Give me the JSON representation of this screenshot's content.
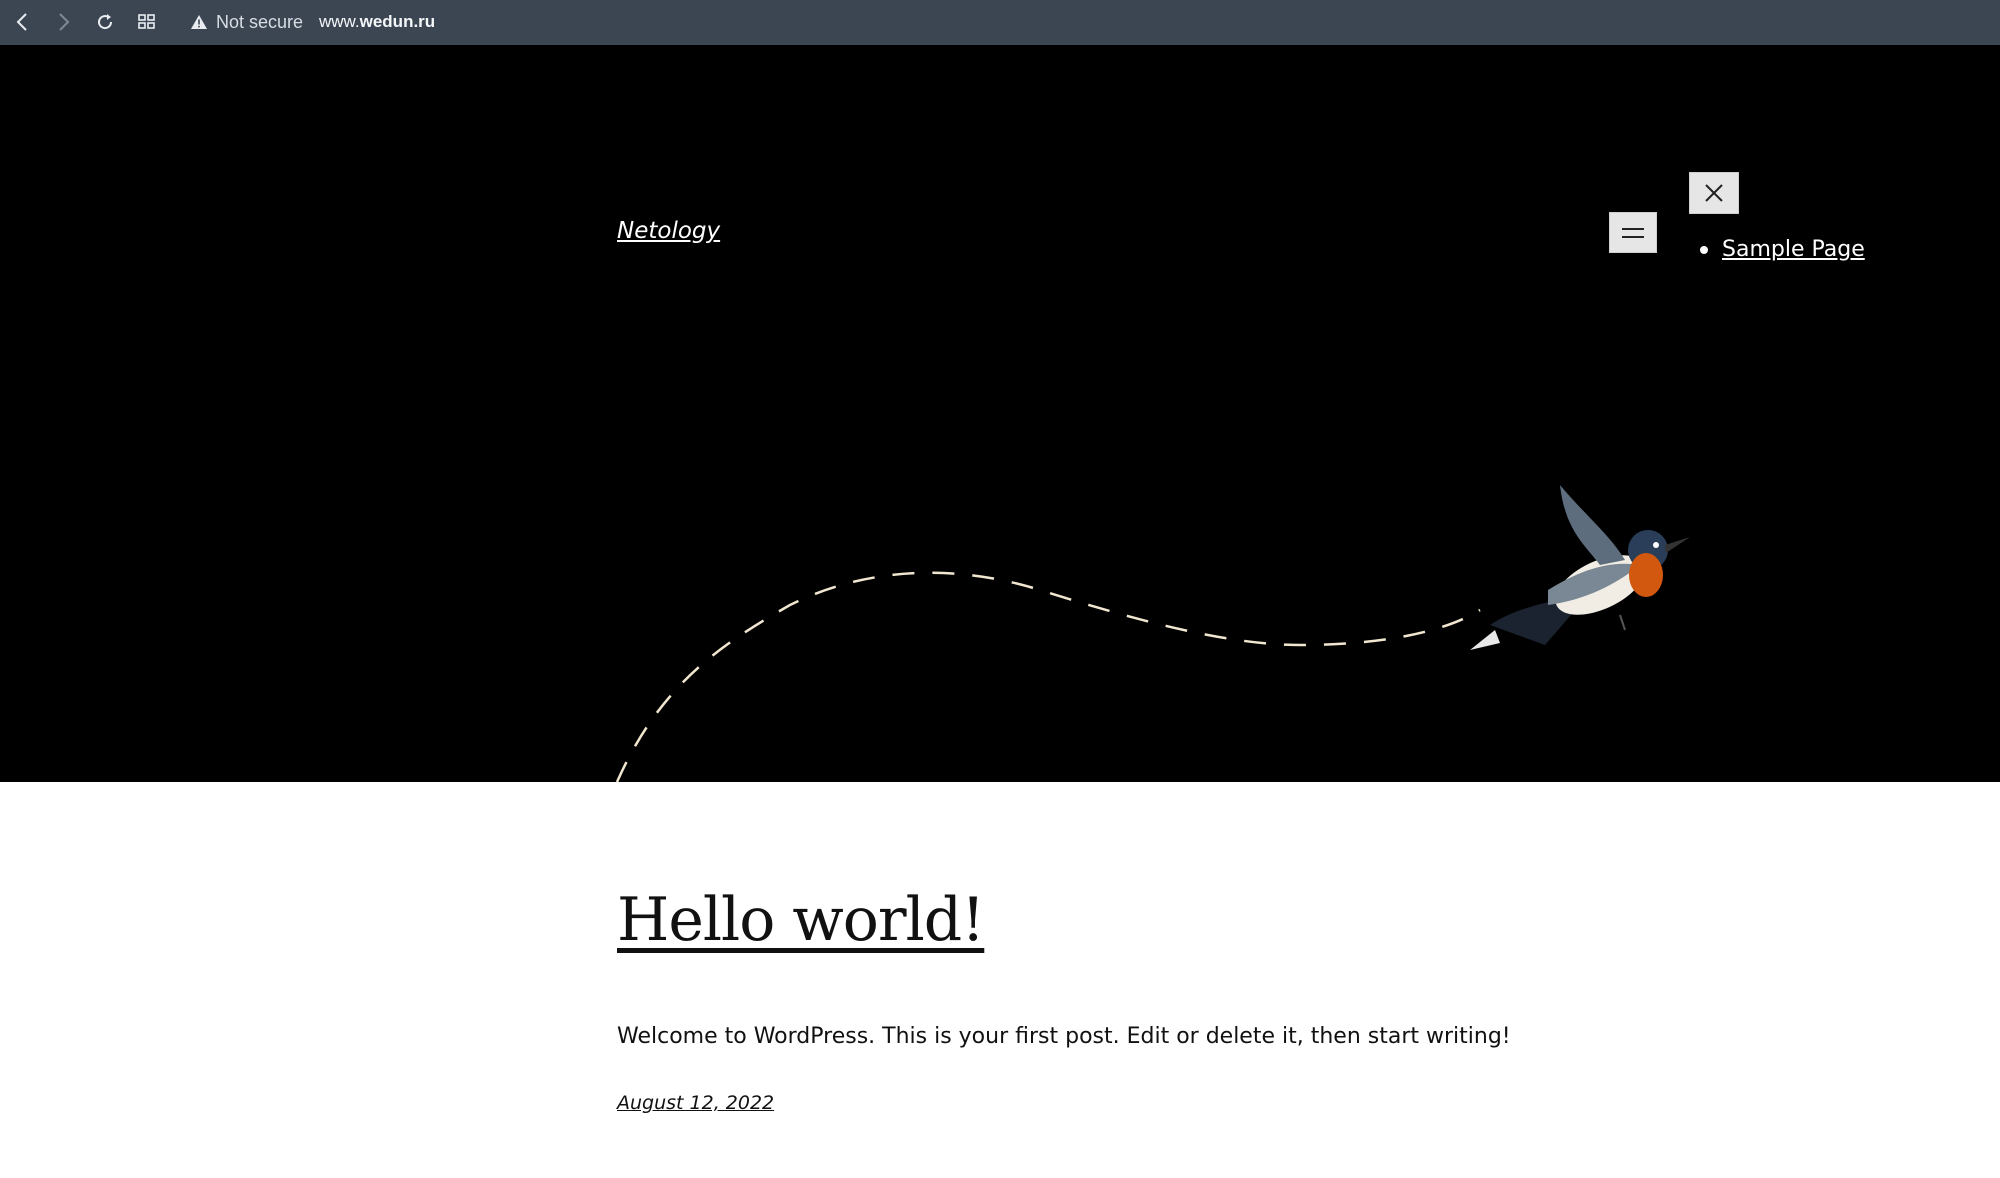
{
  "browser": {
    "security_label": "Not secure",
    "url_prefix": "www.",
    "url_domain": "wedun.ru",
    "icons": [
      "back-icon",
      "forward-icon",
      "reload-icon",
      "tabs-grid-icon",
      "warning-icon"
    ]
  },
  "header": {
    "site_title": "Netology",
    "nav_items": [
      {
        "label": "Sample Page"
      }
    ],
    "open_menu_icon": "hamburger-icon",
    "close_menu_icon": "close-icon",
    "background_color": "#000000"
  },
  "post": {
    "title": "Hello world!",
    "excerpt": "Welcome to WordPress. This is your first post. Edit or delete it, then start writing!",
    "date": "August 12, 2022"
  }
}
